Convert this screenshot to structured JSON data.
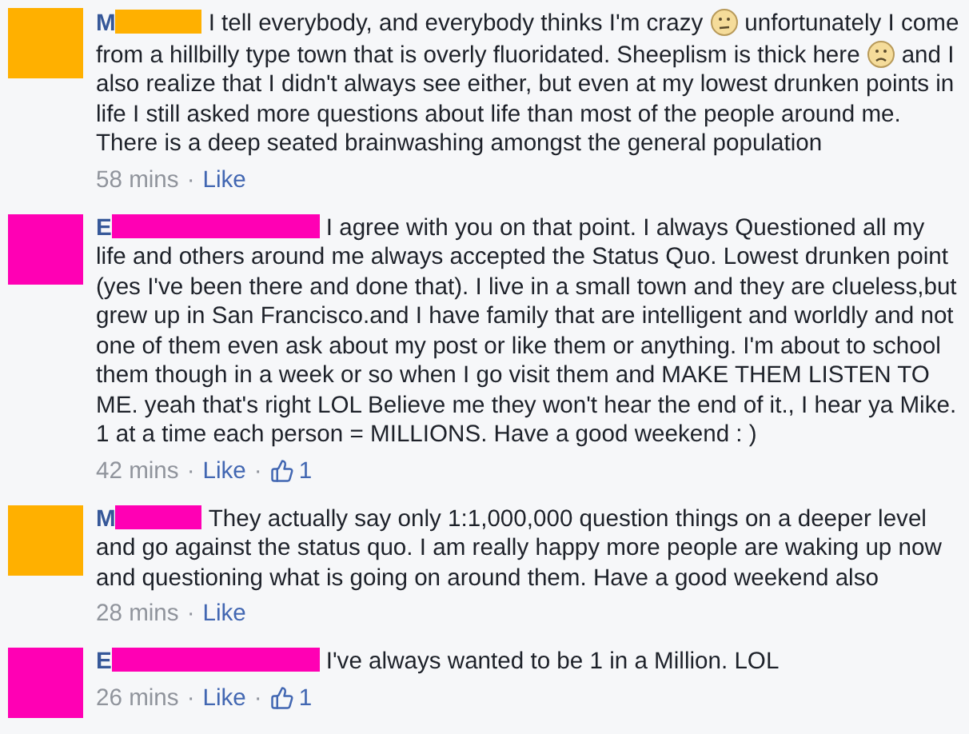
{
  "comments": [
    {
      "avatar": {
        "color": "#ffb000"
      },
      "initial": "M",
      "redaction": {
        "color": "#ffb000"
      },
      "body": [
        {
          "kind": "text",
          "text": "I tell everybody, and everybody thinks I'm crazy"
        },
        {
          "kind": "neutral"
        },
        {
          "kind": "text",
          "text": "unfortunately I come from a hillbilly type town that is overly fluoridated. Sheeplism is thick here"
        },
        {
          "kind": "frown"
        },
        {
          "kind": "text",
          "text": "and I also realize that I didn't always see either, but even at my lowest drunken points in life I still asked more questions about life than most of the people around me. There is a deep seated brainwashing amongst the general population"
        }
      ],
      "actions": [
        {
          "kind": "time",
          "text": "58 mins"
        },
        {
          "kind": "separator",
          "text": "·"
        },
        {
          "kind": "like",
          "text": "Like"
        }
      ]
    },
    {
      "avatar": {
        "color": "#ff00b4"
      },
      "initial": "E",
      "redaction": {
        "color": "#ff00b4"
      },
      "body": [
        {
          "kind": "text",
          "text": "I agree with you on that point. I always Questioned all my life and others around me always accepted the Status Quo. Lowest drunken point (yes I've been there and done that). I live in a small town and they are clueless,but grew up in San Francisco.and I have family that are intelligent and worldly and not one of them even ask about my post or like them or anything. I'm about to school them though in a week or so when I go visit them and MAKE THEM LISTEN TO ME. yeah that's right LOL Believe me they won't hear the end of it., I hear ya Mike. 1 at a time each person = MILLIONS. Have a good weekend : )"
        }
      ],
      "actions": [
        {
          "kind": "time",
          "text": "42 mins"
        },
        {
          "kind": "separator",
          "text": "·"
        },
        {
          "kind": "like",
          "text": "Like"
        },
        {
          "kind": "separator",
          "text": "·"
        },
        {
          "kind": "likes",
          "text": "1"
        }
      ]
    },
    {
      "avatar": {
        "color": "#ffb000"
      },
      "initial": "M",
      "redaction": {
        "color": "#ff00b4"
      },
      "body": [
        {
          "kind": "text",
          "text": "They actually say only 1:1,000,000 question things on a deeper level and go against the status quo. I am really happy more people are waking up now and questioning what is going on around them. Have a good weekend also"
        }
      ],
      "actions": [
        {
          "kind": "time",
          "text": "28 mins"
        },
        {
          "kind": "separator",
          "text": "·"
        },
        {
          "kind": "like",
          "text": "Like"
        }
      ]
    },
    {
      "avatar": {
        "color": "#ff00b4"
      },
      "initial": "E",
      "redaction": {
        "color": "#ff00b4"
      },
      "body": [
        {
          "kind": "text",
          "text": "I've always wanted to be 1 in a Million. LOL"
        }
      ],
      "actions": [
        {
          "kind": "time",
          "text": "26 mins"
        },
        {
          "kind": "separator",
          "text": "·"
        },
        {
          "kind": "like",
          "text": "Like"
        },
        {
          "kind": "separator",
          "text": "·"
        },
        {
          "kind": "likes",
          "text": "1"
        }
      ]
    }
  ]
}
